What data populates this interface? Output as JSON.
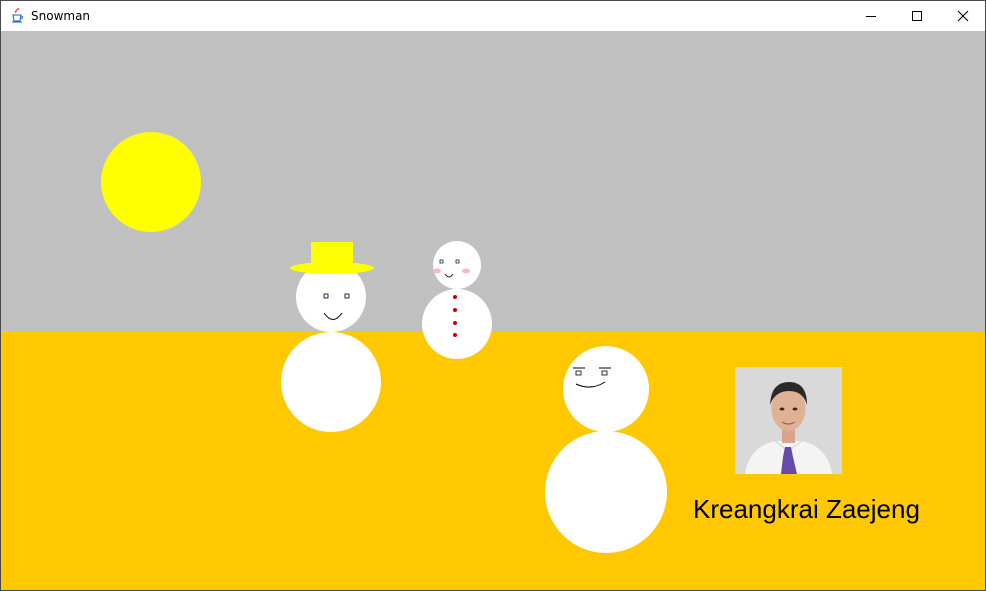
{
  "window": {
    "title": "Snowman",
    "icon": "java-cup-icon",
    "controls": {
      "minimize": "minimize-icon",
      "maximize": "maximize-icon",
      "close": "close-icon"
    }
  },
  "scene": {
    "sky_color": "#c0c0c0",
    "ground_color": "#ffc800",
    "sun_color": "#ffff00",
    "snow_color": "#ffffff",
    "hat_color": "#ffff00",
    "button_color": "#cc0000",
    "blush_color": "#ffb6c1",
    "snowmen": [
      {
        "name": "hat-snowman",
        "features": [
          "hat",
          "eyes",
          "smile"
        ]
      },
      {
        "name": "button-snowman",
        "features": [
          "eyes",
          "blush",
          "smile",
          "buttons"
        ]
      },
      {
        "name": "brow-snowman",
        "features": [
          "eyebrows",
          "eyes",
          "smile"
        ]
      }
    ]
  },
  "author": {
    "name": "Kreangkrai Zaejeng",
    "photo": "portrait-photo"
  }
}
